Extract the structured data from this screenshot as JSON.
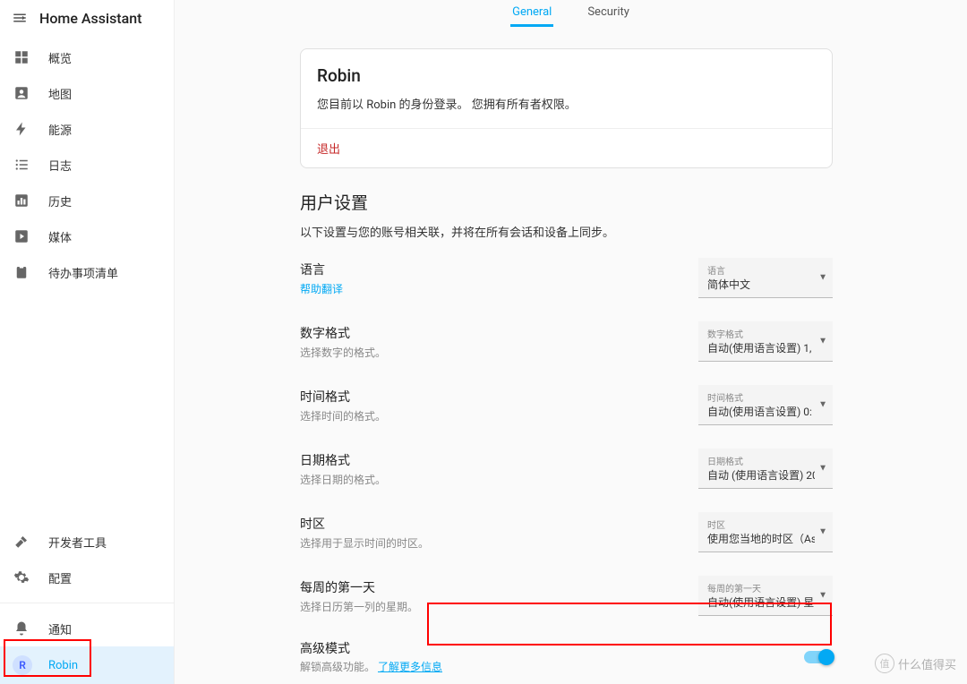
{
  "product": "Home Assistant",
  "sidebar": {
    "items": [
      {
        "label": "概览",
        "icon": "dashboard"
      },
      {
        "label": "地图",
        "icon": "account-box"
      },
      {
        "label": "能源",
        "icon": "bolt"
      },
      {
        "label": "日志",
        "icon": "list"
      },
      {
        "label": "历史",
        "icon": "chart"
      },
      {
        "label": "媒体",
        "icon": "play"
      },
      {
        "label": "待办事项清单",
        "icon": "clipboard"
      }
    ],
    "tools": [
      {
        "label": "开发者工具",
        "icon": "hammer"
      },
      {
        "label": "配置",
        "icon": "gear"
      }
    ],
    "notify": "通知",
    "user": {
      "initial": "R",
      "name": "Robin"
    }
  },
  "tabs": [
    {
      "label": "General",
      "active": true
    },
    {
      "label": "Security",
      "active": false
    }
  ],
  "profile": {
    "name": "Robin",
    "logged_in_as": "您目前以 Robin 的身份登录。 您拥有所有者权限。",
    "logout": "退出"
  },
  "user_settings": {
    "title": "用户设置",
    "desc": "以下设置与您的账号相关联，并将在所有会话和设备上同步。",
    "rows": [
      {
        "title": "语言",
        "sub": "",
        "link": "帮助翻译",
        "dd_label": "语言",
        "dd_value": "简体中文"
      },
      {
        "title": "数字格式",
        "sub": "选择数字的格式。",
        "dd_label": "数字格式",
        "dd_value": "自动(使用语言设置) 1,"
      },
      {
        "title": "时间格式",
        "sub": "选择时间的格式。",
        "dd_label": "时间格式",
        "dd_value": "自动(使用语言设置) 0:"
      },
      {
        "title": "日期格式",
        "sub": "选择日期的格式。",
        "dd_label": "日期格式",
        "dd_value": "自动 (使用语言设置) 20"
      },
      {
        "title": "时区",
        "sub": "选择用于显示时间的时区。",
        "dd_label": "时区",
        "dd_value": "使用您当地的时区（As"
      },
      {
        "title": "每周的第一天",
        "sub": "选择日历第一列的星期。",
        "dd_label": "每周的第一天",
        "dd_value": "自动(使用语言设置) 星"
      }
    ],
    "advanced": {
      "title": "高级模式",
      "sub_prefix": "解锁高级功能。 ",
      "link": "了解更多信息"
    }
  },
  "watermark": "什么值得买"
}
